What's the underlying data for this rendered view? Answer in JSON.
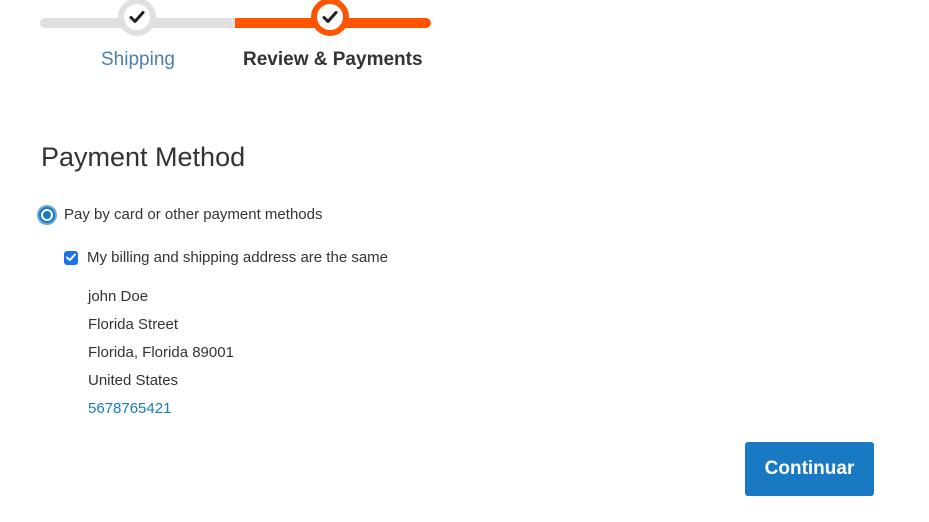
{
  "progress": {
    "steps": [
      {
        "label": "Shipping",
        "state": "completed"
      },
      {
        "label": "Review & Payments",
        "state": "active"
      }
    ],
    "colors": {
      "inactive": "#e0e0e0",
      "active": "#ff5501"
    },
    "icons": {
      "step_marker": "checkmark-icon"
    }
  },
  "payment": {
    "title": "Payment Method",
    "option": {
      "label": "Pay by card or other payment methods",
      "selected": true
    },
    "billing_same": {
      "label": "My billing and shipping address are the same",
      "checked": true
    },
    "address": {
      "name": "john Doe",
      "street": "Florida Street",
      "city_region_zip": "Florida, Florida 89001",
      "country": "United States",
      "phone": "5678765421"
    },
    "continue_label": "Continuar"
  },
  "colors": {
    "primary": "#1979c3",
    "link": "#1979c3"
  }
}
